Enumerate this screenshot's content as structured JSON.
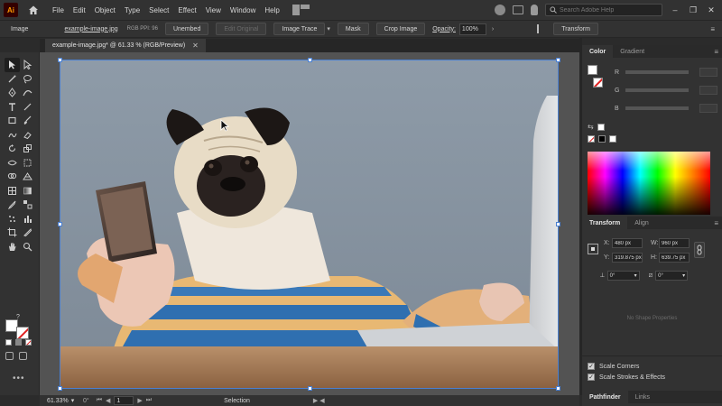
{
  "app": {
    "logo": "Ai",
    "menus": [
      "File",
      "Edit",
      "Object",
      "Type",
      "Select",
      "Effect",
      "View",
      "Window",
      "Help"
    ],
    "search_placeholder": "Search Adobe Help",
    "window_controls": [
      "–",
      "❐",
      "✕"
    ]
  },
  "controlbar": {
    "object_type": "Image",
    "file_link": "example-image.jpg",
    "meta": "RGB   PPI: 96",
    "embed_label": "Unembed",
    "edit_original_label": "Edit Original",
    "image_trace_label": "Image Trace",
    "mask_label": "Mask",
    "crop_label": "Crop Image",
    "opacity_label": "Opacity:",
    "opacity_value": "100%",
    "transform_label": "Transform"
  },
  "document": {
    "tab_title": "example-image.jpg* @ 61.33 % (RGB/Preview)",
    "tab_close": "✕"
  },
  "toolbar": {
    "more_label": "•••",
    "help_label": "?"
  },
  "panels": {
    "color": {
      "tabs": [
        "Color",
        "Gradient"
      ],
      "channels": [
        "R",
        "G",
        "B"
      ]
    },
    "transform": {
      "tabs": [
        "Transform",
        "Align"
      ],
      "x_label": "X:",
      "x_value": "480 px",
      "y_label": "Y:",
      "y_value": "319.875 px",
      "w_label": "W:",
      "w_value": "960 px",
      "h_label": "H:",
      "h_value": "639.75 px",
      "rotate_value": "0°",
      "shear_value": "0°",
      "no_shape": "No Shape Properties"
    },
    "options": {
      "scale_corners": "Scale Corners",
      "scale_strokes": "Scale Strokes & Effects"
    },
    "bottom_tabs": [
      "Pathfinder",
      "Links"
    ]
  },
  "statusbar": {
    "zoom": "61.33%",
    "rotation": "0°",
    "page": "1",
    "tool": "Selection"
  },
  "colors": {
    "accent": "#4a7fd0",
    "logo_bg": "#330000",
    "logo_fg": "#ff9a00"
  }
}
